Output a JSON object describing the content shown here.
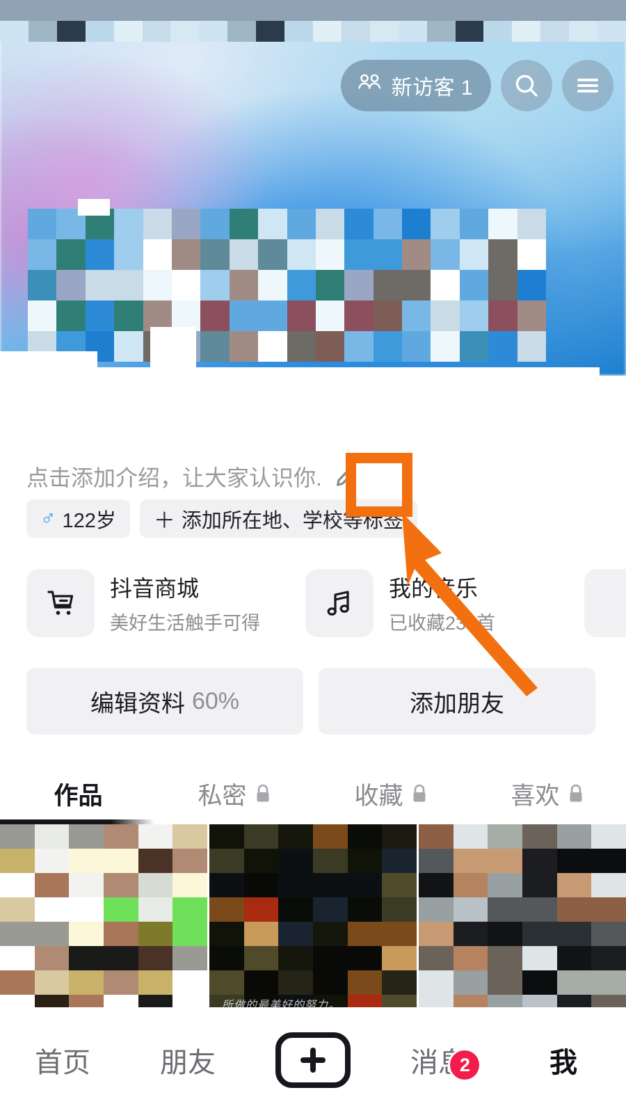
{
  "header": {
    "visitor_pill": {
      "icon": "people-icon",
      "label": "新访客 1"
    },
    "search_icon": "search-icon",
    "menu_icon": "hamburger-menu-icon"
  },
  "profile": {
    "bio_placeholder": "点击添加介绍，让大家认识你.",
    "bio_edit_icon": "pencil-edit-icon",
    "tags": [
      {
        "icon": "male-gender-icon",
        "label": "122岁"
      },
      {
        "icon": "plus-icon",
        "label": "添加所在地、学校等标签"
      }
    ],
    "shortcut_cards": [
      {
        "icon": "shopping-cart-icon",
        "title": "抖音商城",
        "subtitle": "美好生活触手可得"
      },
      {
        "icon": "music-note-icon",
        "title": "我的音乐",
        "subtitle": "已收藏230首"
      }
    ],
    "buttons": [
      {
        "label": "编辑资料",
        "percent": "60%"
      },
      {
        "label": "添加朋友",
        "percent": ""
      }
    ]
  },
  "tabs": [
    {
      "label": "作品",
      "locked": false,
      "active": true
    },
    {
      "label": "私密",
      "locked": true,
      "active": false
    },
    {
      "label": "收藏",
      "locked": true,
      "active": false
    },
    {
      "label": "喜欢",
      "locked": true,
      "active": false
    }
  ],
  "grid": {
    "cells": [
      {
        "caption": ""
      },
      {
        "caption": "所做的最美好的努力。"
      },
      {
        "caption": ""
      }
    ]
  },
  "bottom_nav": [
    {
      "label": "首页",
      "active": false,
      "badge": ""
    },
    {
      "label": "朋友",
      "active": false,
      "badge": ""
    },
    {
      "label": "",
      "icon": "plus-create-icon",
      "active": false,
      "badge": ""
    },
    {
      "label": "消息",
      "active": false,
      "badge": "2"
    },
    {
      "label": "我",
      "active": true,
      "badge": ""
    }
  ],
  "annotation": {
    "type": "highlight-box-with-arrow",
    "target": "bio-edit-pencil-button",
    "color": "#f2700f"
  },
  "colors": {
    "accent_orange": "#f2700f",
    "badge_red": "#f11d4a",
    "chip_grey": "#f1f1f3",
    "text_primary": "#1d1d20",
    "text_muted": "#8e8e93",
    "banner_blue": "#1e7fd0"
  }
}
